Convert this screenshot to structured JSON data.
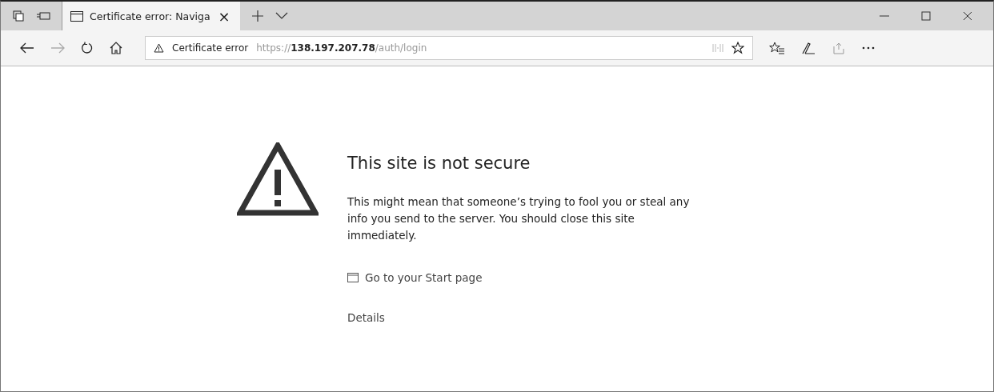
{
  "tabs": [
    {
      "title": "Certificate error: Naviga",
      "close": "×",
      "selected": true
    }
  ],
  "address_bar": {
    "status": "Certificate error",
    "url": "https://**138.197.207.78**/auth/login"
  },
  "page": {
    "heading": "This site is not secure",
    "message": "This might mean that someone’s trying to fool you or steal any info you send to the server. You should close this site immediately.",
    "start_link": "Go to your Start page",
    "details_link": "Details"
  }
}
